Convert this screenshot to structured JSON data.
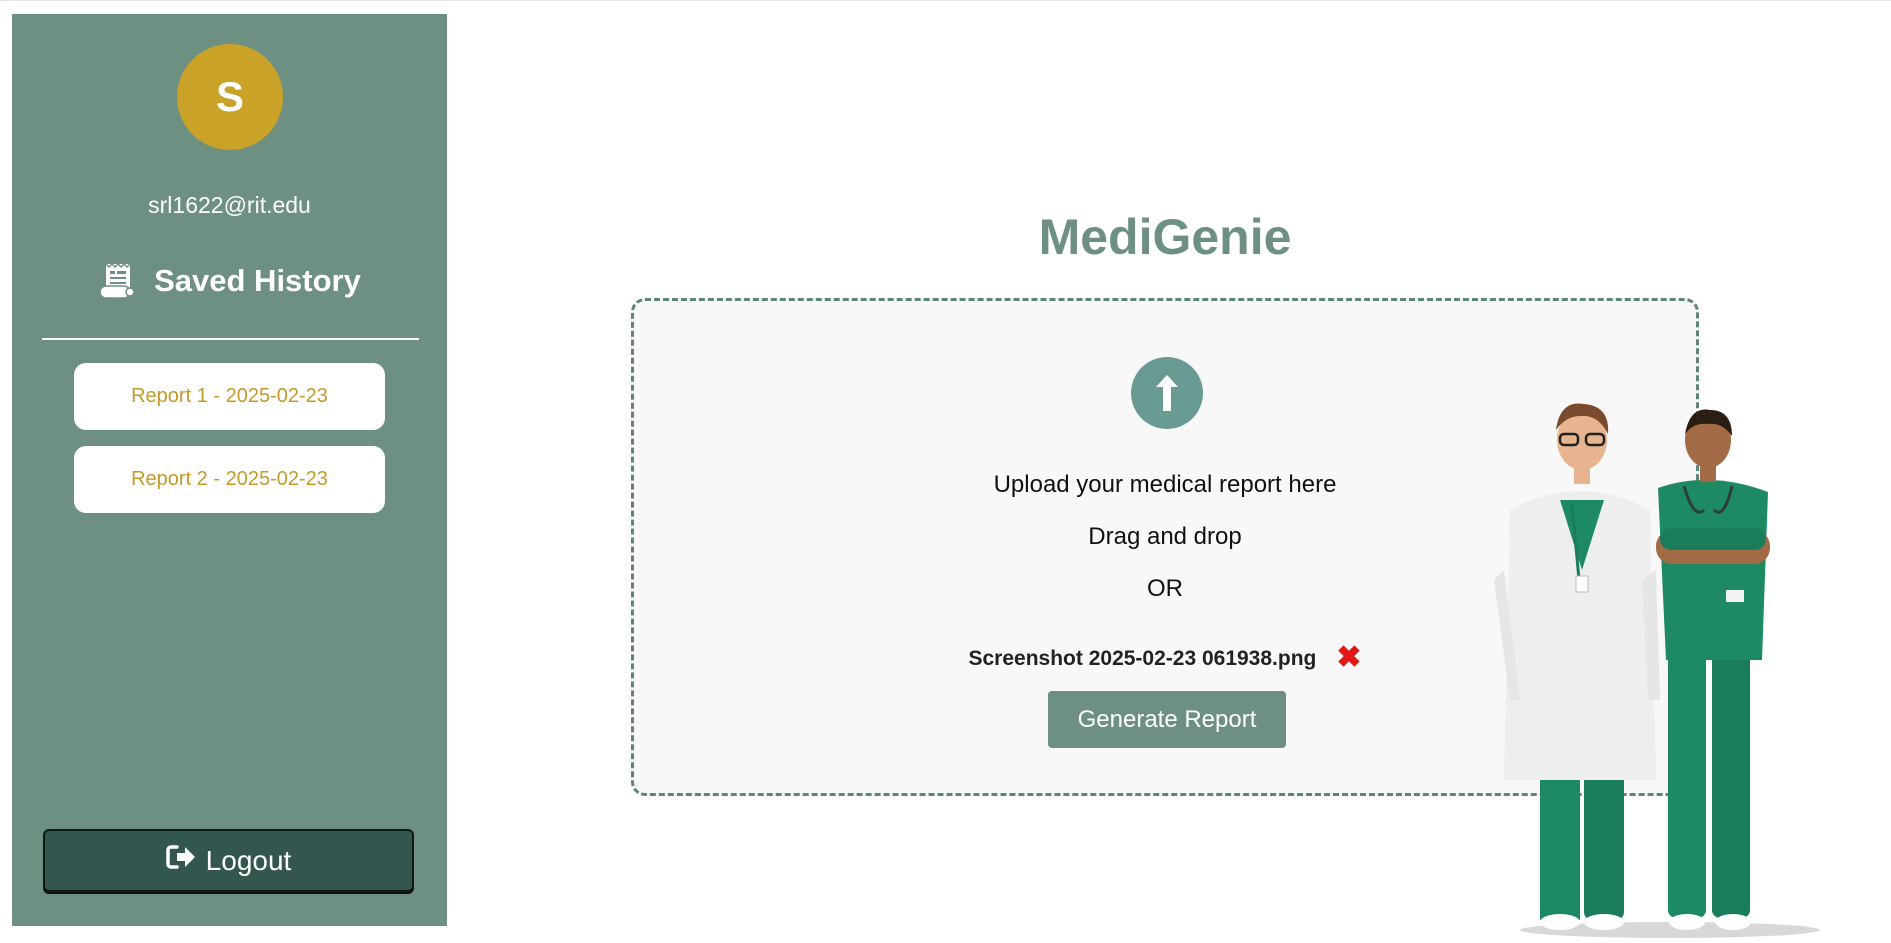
{
  "sidebar": {
    "avatar_initial": "S",
    "email": "srl1622@rit.edu",
    "history_title": "Saved History",
    "history_icon": "receipt-scroll-icon",
    "reports": [
      {
        "label": "Report 1 - 2025-02-23"
      },
      {
        "label": "Report 2 - 2025-02-23"
      }
    ],
    "logout_label": "Logout",
    "logout_icon": "sign-out-icon"
  },
  "main": {
    "title": "MediGenie",
    "upload_icon": "upload-arrow-icon",
    "upload_prompt": "Upload your medical report here",
    "drag_text": "Drag and drop",
    "or_text": "OR",
    "file_name": "Screenshot 2025-02-23 061938.png",
    "remove_icon": "close-x-icon",
    "remove_symbol": "✖",
    "generate_label": "Generate Report"
  },
  "colors": {
    "sidebar_bg": "#6e9083",
    "avatar": "#c9a227",
    "report_text": "#c49a2a",
    "logout_bg": "#33574f",
    "title": "#6e9083",
    "dropzone_border": "#5e8579",
    "upload_circle": "#6a9b92",
    "remove": "#e01818",
    "scrubs": "#1e8a63"
  }
}
